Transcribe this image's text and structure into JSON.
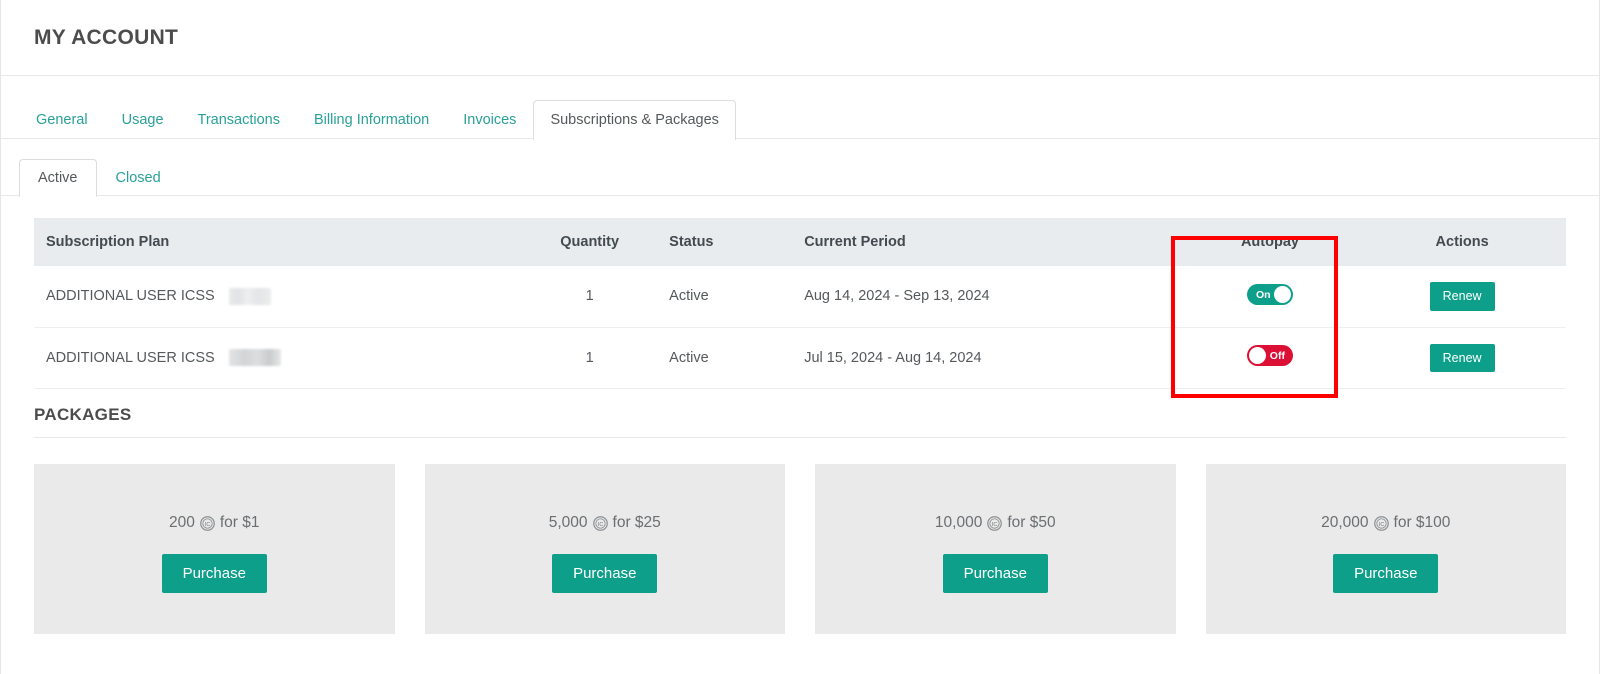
{
  "page": {
    "title": "MY ACCOUNT"
  },
  "tabs": [
    {
      "label": "General",
      "active": false
    },
    {
      "label": "Usage",
      "active": false
    },
    {
      "label": "Transactions",
      "active": false
    },
    {
      "label": "Billing Information",
      "active": false
    },
    {
      "label": "Invoices",
      "active": false
    },
    {
      "label": "Subscriptions & Packages",
      "active": true
    }
  ],
  "subtabs": [
    {
      "label": "Active",
      "active": true
    },
    {
      "label": "Closed",
      "active": false
    }
  ],
  "subscriptions_table": {
    "columns": [
      "Subscription Plan",
      "Quantity",
      "Status",
      "Current Period",
      "Autopay",
      "Actions"
    ],
    "rows": [
      {
        "plan": "ADDITIONAL USER ICSS",
        "plan_redacted": true,
        "quantity": "1",
        "status": "Active",
        "period": "Aug 14, 2024 - Sep 13, 2024",
        "autopay": "On",
        "autopay_state": "on",
        "action": "Renew"
      },
      {
        "plan": "ADDITIONAL USER ICSS",
        "plan_redacted": true,
        "quantity": "1",
        "status": "Active",
        "period": "Jul 15, 2024 - Aug 14, 2024",
        "autopay": "Off",
        "autopay_state": "off",
        "action": "Renew"
      }
    ]
  },
  "packages": {
    "heading": "PACKAGES",
    "cards": [
      {
        "amount": "200",
        "suffix": "for $1",
        "icon": "credit-coin-icon",
        "button": "Purchase"
      },
      {
        "amount": "5,000",
        "suffix": "for $25",
        "icon": "credit-coin-icon",
        "button": "Purchase"
      },
      {
        "amount": "10,000",
        "suffix": "for $50",
        "icon": "credit-coin-icon",
        "button": "Purchase"
      },
      {
        "amount": "20,000",
        "suffix": "for $100",
        "icon": "credit-coin-icon",
        "button": "Purchase"
      }
    ]
  },
  "annotation": {
    "name": "autopay-column-highlight",
    "color": "#fe0000"
  },
  "colors": {
    "accent_teal": "#0e9f8a",
    "link_teal": "#2aa198",
    "toggle_on": "#0e9f8a",
    "toggle_off": "#dc0f35",
    "table_header_bg": "#e8ecef",
    "card_bg": "#eaeaea",
    "annotation_red": "#fe0000"
  }
}
